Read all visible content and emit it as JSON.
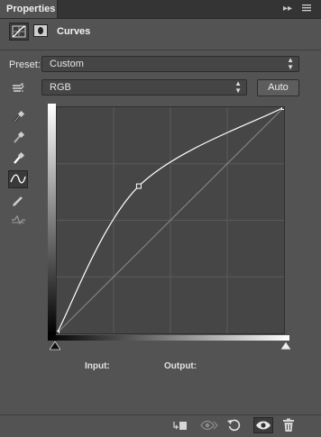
{
  "panel": {
    "tab_label": "Properties",
    "tab_controls": [
      "collapse-icon",
      "menu-icon"
    ]
  },
  "header": {
    "adjustment_icon": "curves-adjustment-icon",
    "mask_icon": "layer-mask-icon",
    "title": "Curves"
  },
  "preset": {
    "label": "Preset:",
    "value": "Custom"
  },
  "channel": {
    "value": "RGB",
    "auto_label": "Auto"
  },
  "tools": [
    {
      "name": "on-image-adjust-tool",
      "icon": "hand-target-icon"
    },
    {
      "name": "black-point-eyedropper",
      "icon": "eyedropper-black-icon"
    },
    {
      "name": "gray-point-eyedropper",
      "icon": "eyedropper-gray-icon"
    },
    {
      "name": "white-point-eyedropper",
      "icon": "eyedropper-white-icon"
    },
    {
      "name": "edit-points-curve-tool",
      "icon": "curve-icon",
      "active": true
    },
    {
      "name": "draw-pencil-tool",
      "icon": "pencil-icon"
    },
    {
      "name": "smooth-curve-tool",
      "icon": "smooth-icon"
    }
  ],
  "curve": {
    "channel": "RGB",
    "range": [
      0,
      255
    ],
    "grid_divisions": 4,
    "control_points": [
      [
        0,
        0
      ],
      [
        92,
        166
      ],
      [
        255,
        255
      ]
    ],
    "colors": {
      "curve": "#ffffff",
      "baseline": "#8a8a8a",
      "grid": "#5a5a5a",
      "background": "#464646"
    }
  },
  "readout": {
    "input_label": "Input:",
    "output_label": "Output:"
  },
  "footer": {
    "icons": [
      "clip-to-layer-icon",
      "view-previous-state-icon",
      "reset-icon",
      "toggle-visibility-icon",
      "trash-icon"
    ]
  }
}
